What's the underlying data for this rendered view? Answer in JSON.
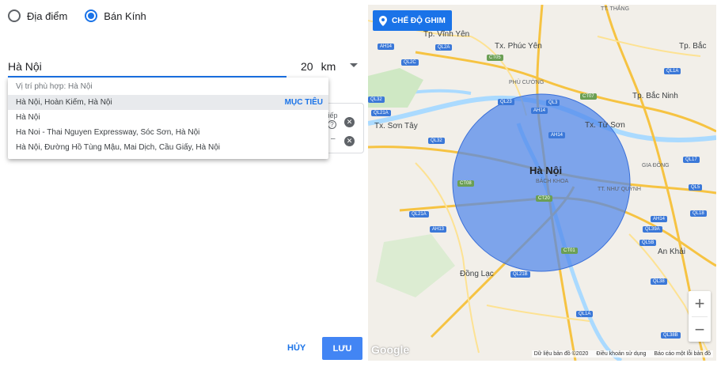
{
  "location_mode": {
    "option_place": "Địa điểm",
    "option_radius": "Bán Kính",
    "selected": "radius"
  },
  "search": {
    "value": "Hà Nội"
  },
  "radius": {
    "value": "20",
    "unit": "km"
  },
  "background_card": {
    "text_fragment": "tiếp",
    "dash": "–"
  },
  "suggestions": {
    "header": "Vị trí phù hợp: Hà Nội",
    "action_label": "MỤC TIÊU",
    "items": [
      "Hà Nội, Hoàn Kiếm, Hà Nội",
      "Hà Nội",
      "Ha Noi - Thai Nguyen Expressway, Sóc Sơn, Hà Nội",
      "Hà Nội, Đường Hồ Tùng Mậu, Mai Dịch, Cầu Giấy, Hà Nội"
    ]
  },
  "footer": {
    "cancel": "HỦY",
    "save": "LƯU"
  },
  "map": {
    "pin_mode_label": "CHẾ ĐỘ GHIM",
    "places": {
      "center": "Hà Nội",
      "bach_khoa": "BÁCH KHOA",
      "vinh_yen": "Tp. Vĩnh Yên",
      "phuc_yen": "Tx. Phúc Yên",
      "phu_cuong": "PHÙ CƯỜNG",
      "bac_ninh": "Tp. Bắc Ninh",
      "bac": "Tp. Bắc",
      "son_tay": "Tx. Sơn Tây",
      "tu_son": "Tx. Từ Sơn",
      "gia_dong": "GIA ĐÔNG",
      "nhu_quynh": "TT. NHƯ QUỲNH",
      "an_khai": "An Khải",
      "dong_lac": "Đồng Lạc",
      "tt_thang": "TT. THẮNG"
    },
    "roads": {
      "ah14_a": "AH14",
      "ql2a": "QL2A",
      "ct05": "CT05",
      "ql2c": "QL2C",
      "ql1a_a": "QL1A",
      "ql23": "QL23",
      "ql3": "QL3",
      "ct07": "CT07",
      "ql32": "QL32",
      "ah14_b": "AH14",
      "ql21a_a": "QL21A",
      "ah14_c": "AH14",
      "ql32b": "QL32",
      "ql17": "QL17",
      "ct08": "CT08",
      "ql5": "QL5",
      "ql21a_b": "QL21A",
      "ct20": "CT20",
      "ql18": "QL18",
      "ah13": "AH13",
      "ah14_d": "AH14",
      "ql39a": "QL39A",
      "ql5b": "QL5B",
      "ct01": "CT01",
      "ql21b": "QL21B",
      "ql38": "QL38",
      "ql1a_b": "QL1A",
      "ql38b": "QL38B"
    },
    "zoom_in": "+",
    "zoom_out": "−",
    "google": "Google",
    "attribution": {
      "data": "Dữ liệu bản đồ ©2020",
      "terms": "Điều khoản sử dụng",
      "report": "Báo cáo một lỗi bản đồ"
    },
    "radius_circle_color": "#4f86ec"
  }
}
